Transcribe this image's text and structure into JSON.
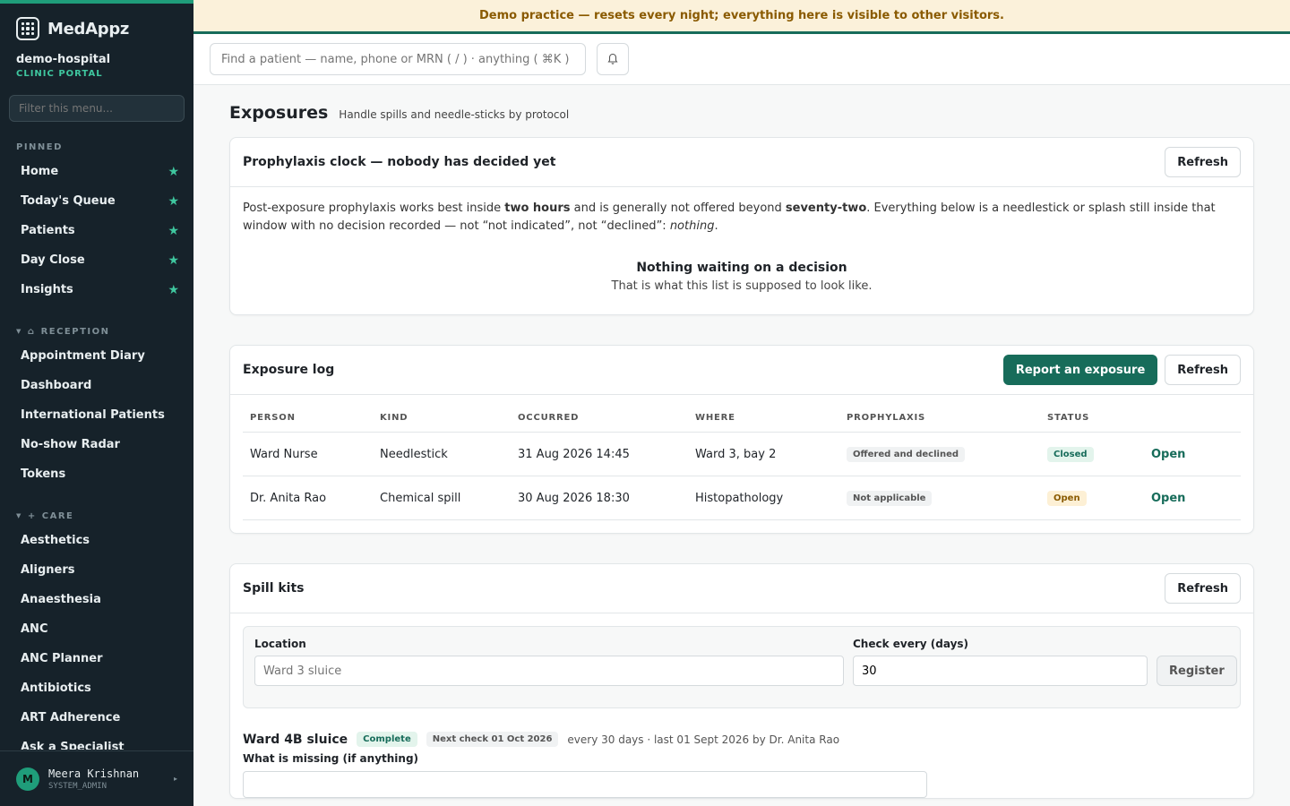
{
  "app": {
    "name": "MedAppz",
    "tenant": "demo-hospital",
    "tenant_sub": "CLINIC PORTAL"
  },
  "sidebar": {
    "filter_placeholder": "Filter this menu...",
    "pinned_label": "PINNED",
    "pinned": [
      {
        "label": "Home"
      },
      {
        "label": "Today's Queue"
      },
      {
        "label": "Patients"
      },
      {
        "label": "Day Close"
      },
      {
        "label": "Insights"
      }
    ],
    "reception_label": "RECEPTION",
    "reception": [
      {
        "label": "Appointment Diary"
      },
      {
        "label": "Dashboard"
      },
      {
        "label": "International Patients"
      },
      {
        "label": "No-show Radar"
      },
      {
        "label": "Tokens"
      }
    ],
    "care_label": "CARE",
    "care": [
      {
        "label": "Aesthetics"
      },
      {
        "label": "Aligners"
      },
      {
        "label": "Anaesthesia"
      },
      {
        "label": "ANC"
      },
      {
        "label": "ANC Planner"
      },
      {
        "label": "Antibiotics"
      },
      {
        "label": "ART Adherence"
      },
      {
        "label": "Ask a Specialist"
      }
    ],
    "user": {
      "initial": "M",
      "name": "Meera Krishnan",
      "role": "SYSTEM_ADMIN"
    }
  },
  "banner": "Demo practice — resets every night; everything here is visible to other visitors.",
  "topbar": {
    "search_placeholder": "Find a patient — name, phone or MRN ( / ) · anything ( ⌘K )"
  },
  "page": {
    "title": "Exposures",
    "subtitle": "Handle spills and needle-sticks by protocol"
  },
  "clock": {
    "title": "Prophylaxis clock — nobody has decided yet",
    "refresh": "Refresh",
    "text_1": "Post-exposure prophylaxis works best inside ",
    "bold_1": "two hours",
    "text_2": " and is generally not offered beyond ",
    "bold_2": "seventy-two",
    "text_3": ". Everything below is a needlestick or splash still inside that window with no decision recorded — not “not indicated”, not “declined”: ",
    "italic": "nothing",
    "text_4": ".",
    "empty_title": "Nothing waiting on a decision",
    "empty_sub": "That is what this list is supposed to look like."
  },
  "log": {
    "title": "Exposure log",
    "report_btn": "Report an exposure",
    "refresh": "Refresh",
    "columns": [
      "PERSON",
      "KIND",
      "OCCURRED",
      "WHERE",
      "PROPHYLAXIS",
      "STATUS"
    ],
    "rows": [
      {
        "person": "Ward Nurse",
        "kind": "Needlestick",
        "occurred": "31 Aug 2026 14:45",
        "where": "Ward 3, bay 2",
        "prophylaxis": "Offered and declined",
        "status": "Closed",
        "action": "Open"
      },
      {
        "person": "Dr. Anita Rao",
        "kind": "Chemical spill",
        "occurred": "30 Aug 2026 18:30",
        "where": "Histopathology",
        "prophylaxis": "Not applicable",
        "status": "Open",
        "action": "Open"
      }
    ]
  },
  "kits": {
    "title": "Spill kits",
    "refresh": "Refresh",
    "location_label": "Location",
    "location_placeholder": "Ward 3 sluice",
    "interval_label": "Check every (days)",
    "interval_value": "30",
    "register_btn": "Register",
    "item": {
      "name": "Ward 4B sluice",
      "badge": "Complete",
      "next_check": "Next check 01 Oct 2026",
      "meta": "every 30 days · last 01 Sept 2026 by Dr. Anita Rao",
      "missing_label": "What is missing (if anything)"
    }
  }
}
